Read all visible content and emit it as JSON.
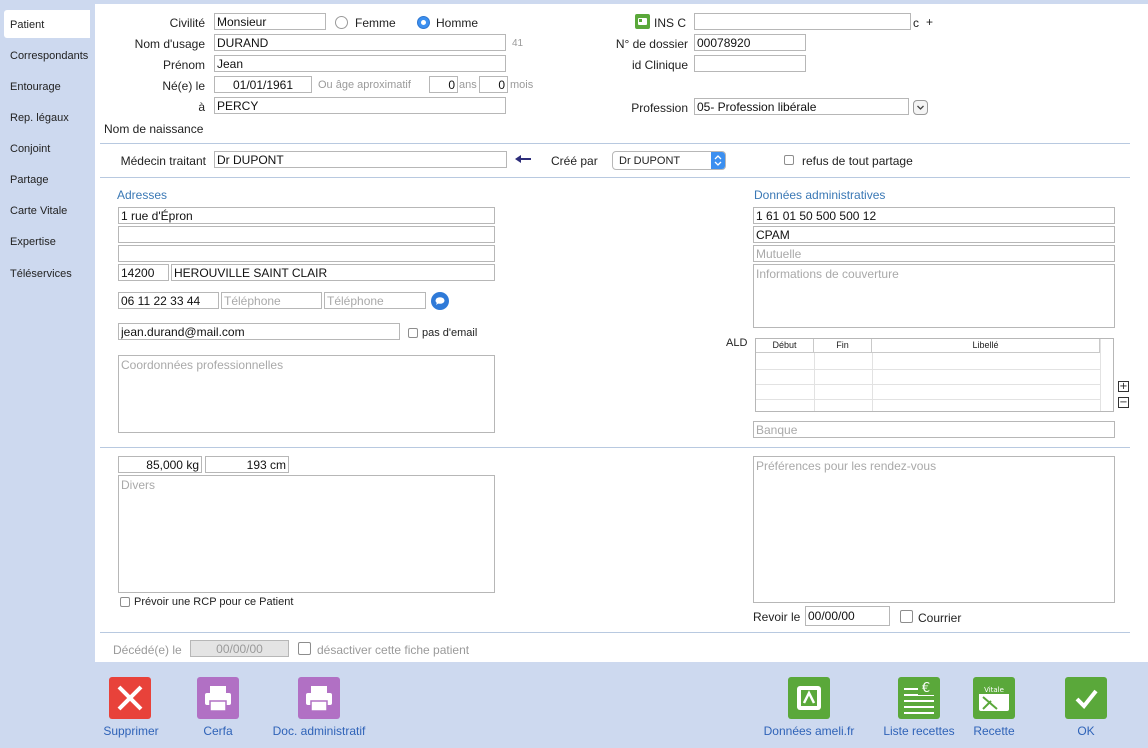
{
  "sidebar": {
    "items": [
      {
        "label": "Patient",
        "active": true
      },
      {
        "label": "Correspondants"
      },
      {
        "label": "Entourage"
      },
      {
        "label": "Rep. légaux"
      },
      {
        "label": "Conjoint"
      },
      {
        "label": "Partage"
      },
      {
        "label": "Carte Vitale"
      },
      {
        "label": "Expertise"
      },
      {
        "label": "Téléservices"
      }
    ]
  },
  "identity": {
    "civilite_label": "Civilité",
    "civilite_value": "Monsieur",
    "femme_label": "Femme",
    "homme_label": "Homme",
    "selected_gender": "Homme",
    "nom_usage_label": "Nom d'usage",
    "nom_usage_value": "DURAND",
    "nom_usage_count": "41",
    "prenom_label": "Prénom",
    "prenom_value": "Jean",
    "ne_le_label": "Né(e) le",
    "ne_le_value": "01/01/1961",
    "age_approx_label": "Ou âge aproximatif",
    "ans_value": "0",
    "ans_label": "ans",
    "mois_value": "0",
    "mois_label": "mois",
    "a_label": "à",
    "a_value": "PERCY",
    "nom_naissance_label": "Nom de naissance"
  },
  "ins": {
    "ins_label": "INS C",
    "ins_value": "",
    "ins_suffix": "c",
    "ins_plus": "+",
    "dossier_label": "N° de dossier",
    "dossier_value": "00078920",
    "clinique_label": "id Clinique",
    "clinique_value": "",
    "profession_label": "Profession",
    "profession_value": "05- Profession libérale"
  },
  "medecin": {
    "label": "Médecin traitant",
    "value": "Dr DUPONT",
    "cree_par_label": "Créé par",
    "cree_par_value": "Dr DUPONT",
    "refus_label": "refus de tout partage"
  },
  "adresses": {
    "title": "Adresses",
    "line1": "1 rue d'Épron",
    "line2": "",
    "line3": "",
    "cp": "14200",
    "ville": "HEROUVILLE SAINT CLAIR",
    "tel1": "06 11 22 33 44",
    "tel_placeholder": "Téléphone",
    "email": "jean.durand@mail.com",
    "pas_email_label": "pas d'email",
    "coord_pro_placeholder": "Coordonnées professionnelles"
  },
  "admin": {
    "title": "Données administratives",
    "secu": "1 61 01 50 500 500 12",
    "caisse": "CPAM",
    "mutuelle_placeholder": "Mutuelle",
    "couverture_placeholder": "Informations de couverture",
    "ald_label": "ALD",
    "ald_columns": [
      "Début",
      "Fin",
      "Libellé"
    ],
    "banque_placeholder": "Banque"
  },
  "physique": {
    "poids": "85,000 kg",
    "taille": "193 cm",
    "divers_placeholder": "Divers",
    "rcp_label": "Prévoir une RCP pour ce Patient"
  },
  "rdv": {
    "preferences_placeholder": "Préférences pour les rendez-vous",
    "revoir_label": "Revoir le",
    "revoir_value": "00/00/00",
    "courrier_label": "Courrier"
  },
  "deces": {
    "label": "Décédé(e) le",
    "value": "00/00/00",
    "desactiver_label": "désactiver cette fiche patient"
  },
  "toolbar": {
    "supprimer": "Supprimer",
    "cerfa": "Cerfa",
    "doc_admin": "Doc. administratif",
    "ameli": "Données ameli.fr",
    "liste_recettes": "Liste recettes",
    "recette": "Recette",
    "ok": "OK"
  },
  "colors": {
    "background": "#cdd9ef",
    "section_title": "#3a78b5",
    "toolbar_label": "#2f63b8",
    "delete_red": "#e8423a",
    "print_purple": "#b170c4",
    "green": "#5aa83a"
  }
}
